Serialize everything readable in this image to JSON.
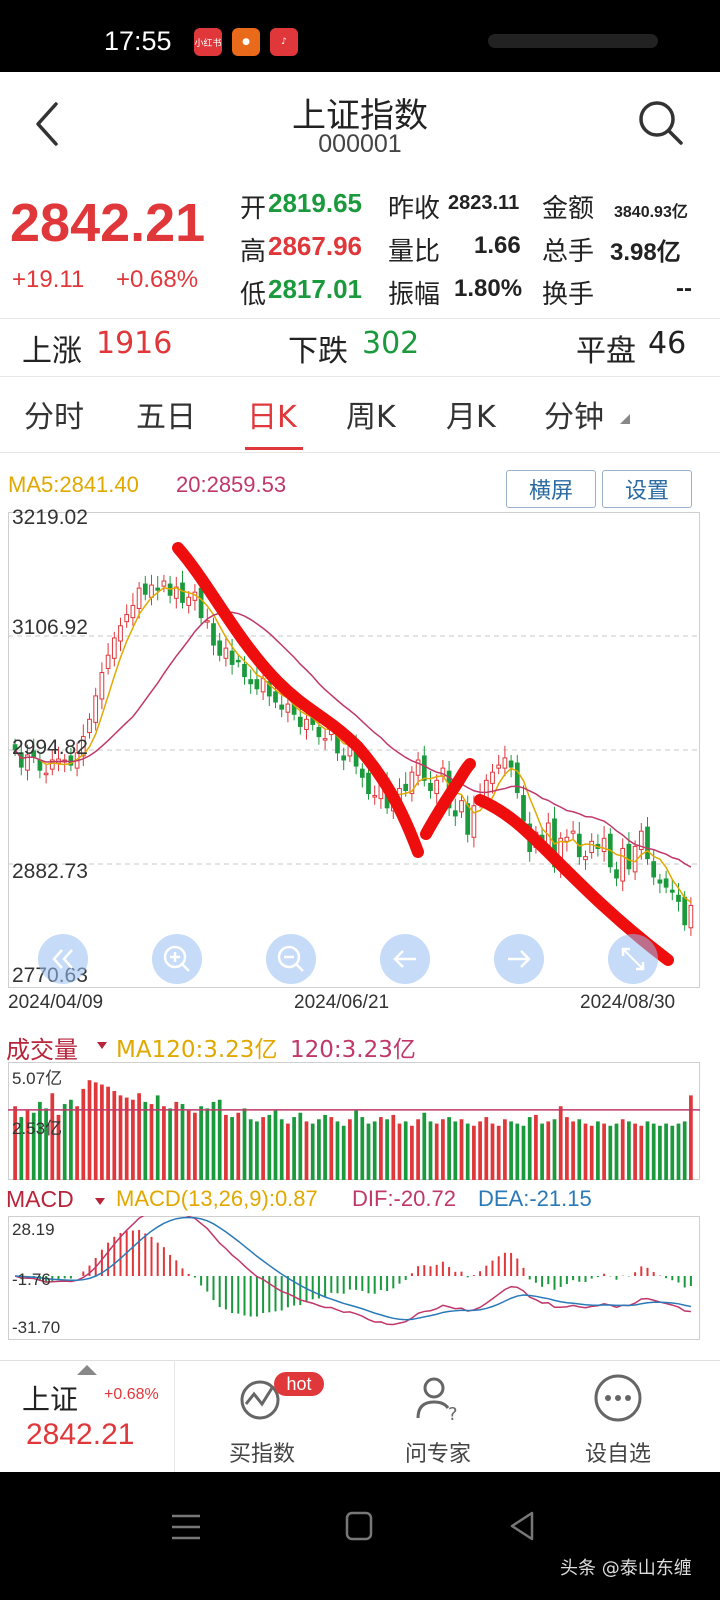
{
  "status_bar": {
    "time": "17:55"
  },
  "header": {
    "title": "上证指数",
    "code": "000001"
  },
  "quote": {
    "price": "2842.21",
    "change": "+19.11",
    "change_pct": "+0.68%",
    "fields": {
      "open_label": "开",
      "open": "2819.65",
      "prev_close_label": "昨收",
      "prev_close": "2823.11",
      "amount_label": "金额",
      "amount": "3840.93亿",
      "high_label": "高",
      "high": "2867.96",
      "volume_ratio_label": "量比",
      "volume_ratio": "1.66",
      "total_volume_label": "总手",
      "total_volume": "3.98亿",
      "low_label": "低",
      "low": "2817.01",
      "amplitude_label": "振幅",
      "amplitude": "1.80%",
      "turnover_label": "换手",
      "turnover": "--"
    }
  },
  "breadth": {
    "up_label": "上涨",
    "up": "1916",
    "down_label": "下跌",
    "down": "302",
    "flat_label": "平盘",
    "flat": "46"
  },
  "tabs": [
    {
      "label": "分时"
    },
    {
      "label": "五日"
    },
    {
      "label": "日K"
    },
    {
      "label": "周K"
    },
    {
      "label": "月K"
    },
    {
      "label": "分钟"
    }
  ],
  "active_tab": "日K",
  "indicators": {
    "ma5": "MA5:2841.40",
    "ma20": "20:2859.53",
    "landscape_button": "横屏",
    "settings_button": "设置"
  },
  "chart_data": [
    {
      "type": "candlestick",
      "title": "",
      "y_ticks": [
        "3219.02",
        "3106.92",
        "2994.82",
        "2882.73",
        "2770.63"
      ],
      "ylim": [
        2770.63,
        3219.02
      ],
      "x_ticks": [
        "2024/04/09",
        "2024/06/21",
        "2024/08/30"
      ],
      "grid": true,
      "series": [
        {
          "name": "MA5",
          "color": "#e0a800"
        },
        {
          "name": "20",
          "color": "#c0386a"
        }
      ],
      "close": [
        2995,
        2978,
        2990,
        2988,
        2975,
        2972,
        2985,
        2986,
        2985,
        2980,
        2992,
        3008,
        3025,
        3048,
        3071,
        3088,
        3105,
        3117,
        3128,
        3137,
        3154,
        3148,
        3157,
        3152,
        3161,
        3147,
        3155,
        3140,
        3145,
        3150,
        3125,
        3122,
        3098,
        3088,
        3095,
        3079,
        3082,
        3067,
        3060,
        3055,
        3065,
        3048,
        3042,
        3035,
        3040,
        3030,
        3018,
        3025,
        3020,
        3008,
        3006,
        3015,
        2992,
        2985,
        3001,
        2979,
        2968,
        2952,
        2950,
        2963,
        2938,
        2948,
        2957,
        2955,
        2973,
        2985,
        2965,
        2955,
        2965,
        2977,
        2938,
        2930,
        2945,
        2912,
        2940,
        2950,
        2965,
        2973,
        2980,
        2987,
        2978,
        2953,
        2925,
        2895,
        2914,
        2900,
        2923,
        2880,
        2908,
        2909,
        2915,
        2890,
        2890,
        2905,
        2898,
        2908,
        2880,
        2869,
        2898,
        2878,
        2900,
        2915,
        2888,
        2870,
        2864,
        2860,
        2855,
        2846,
        2823,
        2842
      ],
      "annotations": "hand-drawn red downtrend strokes"
    },
    {
      "type": "bar",
      "title": "成交量",
      "series": [
        {
          "name": "MA120",
          "label": "MA120:3.23亿"
        },
        {
          "name": "120",
          "label": "120:3.23亿"
        }
      ],
      "y_ticks": [
        "5.07亿",
        "2.53亿"
      ],
      "values_yi": [
        3.4,
        2.9,
        3.2,
        3.1,
        3.6,
        3.3,
        4.0,
        3.0,
        3.5,
        3.7,
        3.4,
        4.2,
        4.6,
        4.5,
        4.4,
        4.3,
        4.1,
        3.9,
        3.8,
        3.7,
        4.0,
        3.6,
        3.5,
        3.9,
        3.4,
        3.3,
        3.6,
        3.5,
        3.2,
        3.1,
        3.4,
        3.3,
        3.6,
        3.7,
        3.0,
        2.9,
        3.1,
        3.3,
        2.8,
        2.7,
        2.9,
        3.0,
        3.2,
        2.8,
        2.6,
        2.9,
        3.1,
        2.7,
        2.6,
        2.8,
        3.0,
        2.9,
        2.7,
        2.5,
        2.8,
        3.2,
        2.9,
        2.6,
        2.7,
        2.9,
        2.8,
        3.0,
        2.6,
        2.7,
        2.5,
        2.8,
        3.1,
        2.7,
        2.6,
        2.8,
        2.9,
        2.7,
        2.8,
        2.6,
        2.5,
        2.7,
        2.9,
        2.6,
        2.5,
        2.8,
        2.7,
        2.6,
        2.5,
        2.9,
        3.0,
        2.6,
        2.7,
        2.8,
        3.4,
        2.9,
        2.7,
        2.8,
        2.6,
        2.5,
        2.7,
        2.6,
        2.5,
        2.6,
        2.8,
        2.7,
        2.6,
        2.5,
        2.7,
        2.6,
        2.5,
        2.6,
        2.5,
        2.6,
        2.7,
        3.9
      ]
    },
    {
      "type": "bar",
      "title": "MACD",
      "params": "MACD(13,26,9):0.87",
      "dif": "DIF:-20.72",
      "dea": "DEA:-21.15",
      "y_ticks": [
        "28.19",
        "-1.76",
        "-31.70"
      ]
    }
  ],
  "bottom_bar": {
    "index_name": "上证",
    "index_pct": "+0.68%",
    "index_price": "2842.21",
    "items": [
      {
        "label": "买指数",
        "badge": "hot"
      },
      {
        "label": "问专家"
      },
      {
        "label": "设自选"
      }
    ]
  },
  "watermark": "头条 @泰山东缠",
  "colors": {
    "up": "#e0373b",
    "down": "#1a9a3c",
    "ma5": "#e0a800",
    "ma20": "#c0386a"
  }
}
